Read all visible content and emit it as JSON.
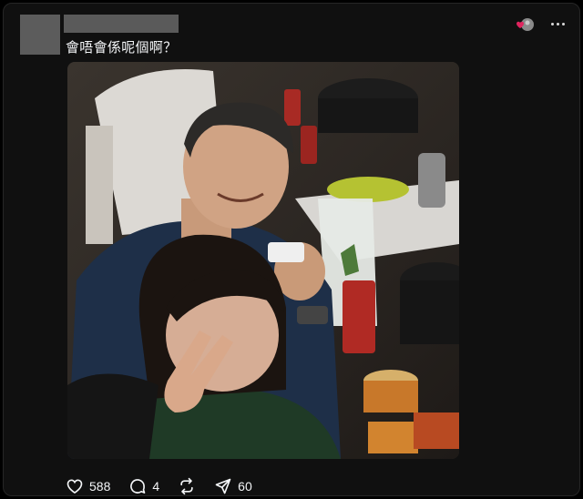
{
  "post": {
    "text": "會唔會係呢個啊？"
  },
  "actions": {
    "like": {
      "icon": "heart-icon",
      "count": "588"
    },
    "reply": {
      "icon": "comment-icon",
      "count": "4"
    },
    "repost": {
      "icon": "repost-icon"
    },
    "share": {
      "icon": "send-icon",
      "count": "60"
    }
  },
  "header": {
    "badge_icon": "heart-avatar-badge-icon",
    "more_icon": "more-horizontal-icon"
  },
  "colors": {
    "background": "#101010",
    "text": "#f3f5f7",
    "badge_red": "#e0245e"
  }
}
